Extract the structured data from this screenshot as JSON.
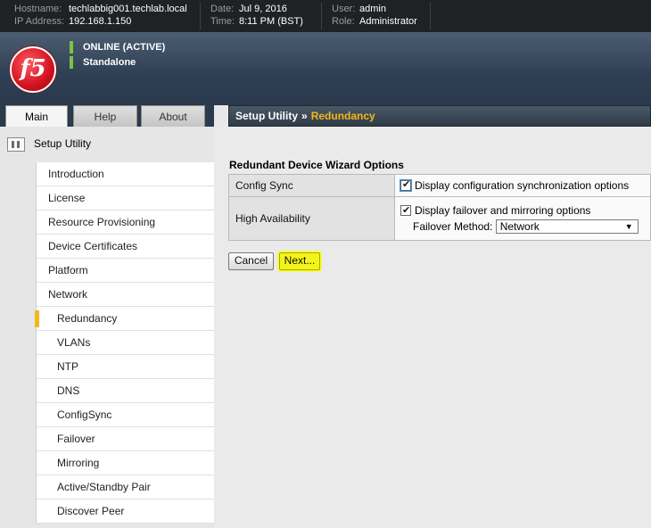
{
  "header": {
    "hostname_label": "Hostname:",
    "hostname": "techlabbig001.techlab.local",
    "ip_label": "IP Address:",
    "ip": "192.168.1.150",
    "date_label": "Date:",
    "date": "Jul 9, 2016",
    "time_label": "Time:",
    "time": "8:11 PM (BST)",
    "user_label": "User:",
    "user": "admin",
    "role_label": "Role:",
    "role": "Administrator"
  },
  "banner": {
    "logo_text": "f5",
    "status": "ONLINE (ACTIVE)",
    "mode": "Standalone",
    "status_color": "#7dc242"
  },
  "tabs": [
    {
      "label": "Main",
      "active": true
    },
    {
      "label": "Help",
      "active": false
    },
    {
      "label": "About",
      "active": false
    }
  ],
  "breadcrumb": {
    "parent": "Setup Utility",
    "separator": "»",
    "current": "Redundancy",
    "current_color": "#f2b81d"
  },
  "nav": {
    "title": "Setup Utility",
    "icon": "setup-utility-icon",
    "items": [
      {
        "label": "Introduction"
      },
      {
        "label": "License"
      },
      {
        "label": "Resource Provisioning"
      },
      {
        "label": "Device Certificates"
      },
      {
        "label": "Platform"
      },
      {
        "label": "Network"
      },
      {
        "label": "Redundancy"
      },
      {
        "label": "VLANs"
      },
      {
        "label": "NTP"
      },
      {
        "label": "DNS"
      },
      {
        "label": "ConfigSync"
      },
      {
        "label": "Failover"
      },
      {
        "label": "Mirroring"
      },
      {
        "label": "Active/Standby Pair"
      },
      {
        "label": "Discover Peer"
      }
    ]
  },
  "form": {
    "title": "Redundant Device Wizard Options",
    "config_sync_label": "Config Sync",
    "config_sync_option": "Display configuration synchronization options",
    "ha_label": "High Availability",
    "ha_option": "Display failover and mirroring options",
    "failover_method_label": "Failover Method:",
    "failover_method_value": "Network",
    "cancel_label": "Cancel",
    "next_label": "Next...",
    "highlight_color": "#f4f41a"
  }
}
